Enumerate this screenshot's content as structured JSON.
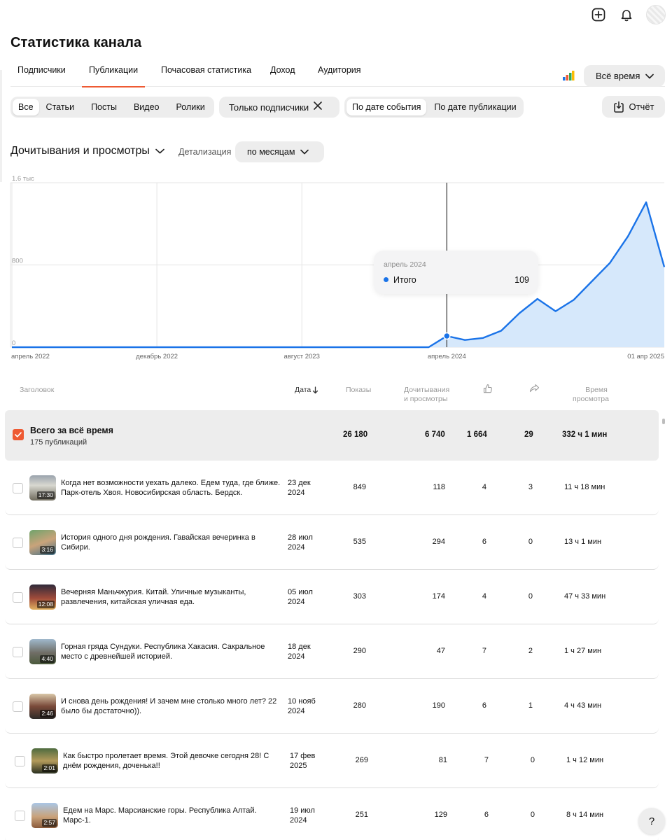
{
  "page": {
    "title": "Статистика канала"
  },
  "tabs": [
    {
      "label": "Подписчики",
      "active": false
    },
    {
      "label": "Публикации",
      "active": true
    },
    {
      "label": "Почасовая статистика",
      "active": false
    },
    {
      "label": "Доход",
      "active": false
    },
    {
      "label": "Аудитория",
      "active": false
    }
  ],
  "period": {
    "label": "Всё время"
  },
  "filters": {
    "types": [
      "Все",
      "Статьи",
      "Посты",
      "Видео",
      "Ролики"
    ],
    "selected_type": "Все",
    "subscribers_chip": "Только подписчики",
    "date_modes": [
      "По дате события",
      "По дате публикации"
    ],
    "selected_date_mode": "По дате события"
  },
  "report": {
    "label": "Отчёт"
  },
  "chart_header": {
    "metric": "Дочитывания и просмотры",
    "detail_label": "Детализация",
    "detail_value": "по месяцам"
  },
  "tooltip": {
    "date": "апрель 2024",
    "series": "Итого",
    "value": "109"
  },
  "colors": {
    "accent": "#ee5a33",
    "line": "#1a73e8",
    "area": "#d6e8fb"
  },
  "chart_data": {
    "type": "area",
    "title": "",
    "xlabel": "",
    "ylabel": "",
    "ylim": [
      0,
      1600
    ],
    "y_tick_labels": [
      "0",
      "800",
      "1.6 тыс"
    ],
    "y_tick_values": [
      0,
      800,
      1600
    ],
    "x_tick_labels": [
      "апрель 2022",
      "декабрь 2022",
      "август 2023",
      "апрель 2024",
      "01 апр 2025"
    ],
    "x_tick_index": [
      0,
      8,
      16,
      24,
      36
    ],
    "grid": true,
    "x": [
      "2022-04",
      "2022-05",
      "2022-06",
      "2022-07",
      "2022-08",
      "2022-09",
      "2022-10",
      "2022-11",
      "2022-12",
      "2023-01",
      "2023-02",
      "2023-03",
      "2023-04",
      "2023-05",
      "2023-06",
      "2023-07",
      "2023-08",
      "2023-09",
      "2023-10",
      "2023-11",
      "2023-12",
      "2024-01",
      "2024-02",
      "2024-03",
      "2024-04",
      "2024-05",
      "2024-06",
      "2024-07",
      "2024-08",
      "2024-09",
      "2024-10",
      "2024-11",
      "2024-12",
      "2025-01",
      "2025-02",
      "2025-03",
      "2025-04"
    ],
    "series": [
      {
        "values": [
          0,
          0,
          0,
          0,
          0,
          0,
          0,
          0,
          0,
          0,
          0,
          0,
          0,
          0,
          0,
          0,
          0,
          0,
          0,
          0,
          0,
          0,
          0,
          0,
          109,
          70,
          90,
          160,
          330,
          470,
          350,
          460,
          640,
          820,
          1080,
          1410,
          780
        ]
      }
    ],
    "highlight_index": 24
  },
  "table": {
    "headers": {
      "title": "Заголовок",
      "date": "Дата",
      "shows": "Показы",
      "reads_line1": "Дочитывания",
      "reads_line2": "и просмотры",
      "time_line1": "Время",
      "time_line2": "просмотра"
    },
    "total": {
      "title": "Всего за всё время",
      "subtitle": "175 публикаций",
      "shows": "26 180",
      "reads": "6 740",
      "likes": "1 664",
      "shares": "29",
      "time": "332 ч 1 мин"
    },
    "rows": [
      {
        "duration": "17:30",
        "title": "Когда нет возможности уехать далеко. Едем туда, где ближе. Парк-отель Хвоя. Новосибирская область. Бердск. Выходные...",
        "date1": "23 дек",
        "date2": "2024",
        "shows": "849",
        "reads": "118",
        "likes": "4",
        "shares": "3",
        "time": "11 ч 18 мин"
      },
      {
        "duration": "3:16",
        "title": "История одного дня рождения. Гавайская вечеринка в Сибири.",
        "date1": "28 июл",
        "date2": "2024",
        "shows": "535",
        "reads": "294",
        "likes": "6",
        "shares": "0",
        "time": "13 ч 1 мин"
      },
      {
        "duration": "12:08",
        "title": "Вечерняя Маньчжурия. Китай. Уличные музыканты, развлечения, китайская уличная еда.",
        "date1": "05 июл",
        "date2": "2024",
        "shows": "303",
        "reads": "174",
        "likes": "4",
        "shares": "0",
        "time": "47 ч 33 мин"
      },
      {
        "duration": "4:40",
        "title": "Горная гряда Сундуки. Республика Хакасия. Сакральное место с древнейшей историей.",
        "date1": "18 дек",
        "date2": "2024",
        "shows": "290",
        "reads": "47",
        "likes": "7",
        "shares": "2",
        "time": "1 ч 27 мин"
      },
      {
        "duration": "2:46",
        "title": "И снова день рождения! И зачем мне столько много лет? 22 было бы достаточно)).",
        "date1": "10 нояб",
        "date2": "2024",
        "shows": "280",
        "reads": "190",
        "likes": "6",
        "shares": "1",
        "time": "4 ч 43 мин"
      },
      {
        "duration": "2:01",
        "title": "Как быстро пролетает время. Этой девочке сегодня 28! С днём рождения, доченька!!",
        "date1": "17 фев",
        "date2": "2025",
        "shows": "269",
        "reads": "81",
        "likes": "7",
        "shares": "0",
        "time": "1 ч 12 мин"
      },
      {
        "duration": "2:57",
        "title": "Едем на Марс. Марсианские горы. Республика Алтай. Марс-1.",
        "date1": "19 июл",
        "date2": "2024",
        "shows": "251",
        "reads": "129",
        "likes": "6",
        "shares": "0",
        "time": "8 ч 14 мин"
      }
    ]
  },
  "help": {
    "label": "?"
  }
}
